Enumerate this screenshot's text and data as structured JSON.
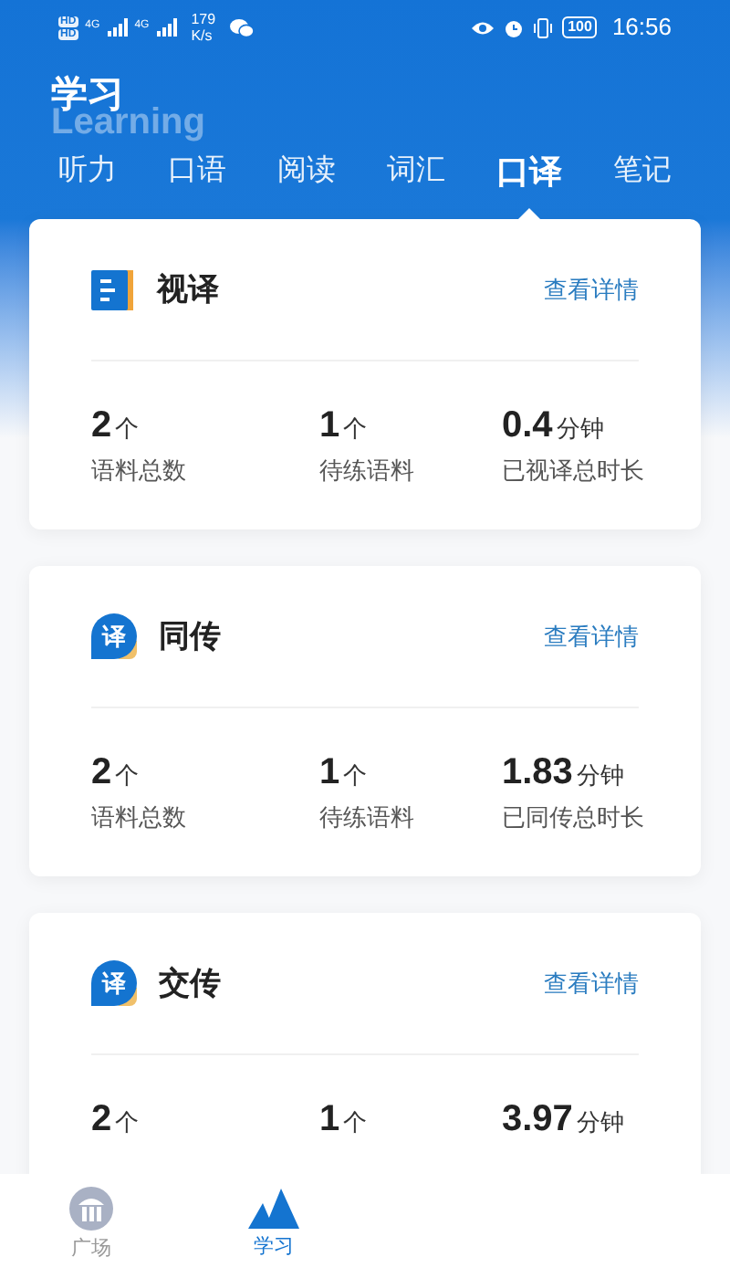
{
  "status_bar": {
    "sim_labels": [
      "HD",
      "HD"
    ],
    "network_labels": [
      "4G",
      "4G"
    ],
    "speed": "179",
    "speed_unit": "K/s",
    "battery": "100",
    "time": "16:56"
  },
  "header": {
    "title": "学习",
    "subtitle": "Learning"
  },
  "tabs": [
    {
      "label": "听力",
      "selected": false
    },
    {
      "label": "口语",
      "selected": false
    },
    {
      "label": "阅读",
      "selected": false
    },
    {
      "label": "词汇",
      "selected": false
    },
    {
      "label": "口译",
      "selected": true
    },
    {
      "label": "笔记",
      "selected": false
    }
  ],
  "cards": [
    {
      "kind": "document",
      "title": "视译",
      "link": "查看详情",
      "stats": [
        {
          "value": "2",
          "unit": "个",
          "label": "语料总数"
        },
        {
          "value": "1",
          "unit": "个",
          "label": "待练语料"
        },
        {
          "value": "0.4",
          "unit": "分钟",
          "label": "已视译总时长"
        }
      ]
    },
    {
      "kind": "badge",
      "badge": "译",
      "title": "同传",
      "link": "查看详情",
      "stats": [
        {
          "value": "2",
          "unit": "个",
          "label": "语料总数"
        },
        {
          "value": "1",
          "unit": "个",
          "label": "待练语料"
        },
        {
          "value": "1.83",
          "unit": "分钟",
          "label": "已同传总时长"
        }
      ]
    },
    {
      "kind": "badge",
      "badge": "译",
      "title": "交传",
      "link": "查看详情",
      "stats": [
        {
          "value": "2",
          "unit": "个"
        },
        {
          "value": "1",
          "unit": "个"
        },
        {
          "value": "3.97",
          "unit": "分钟"
        }
      ]
    }
  ],
  "bottom_nav": [
    {
      "kind": "plaza",
      "label": "广场",
      "selected": false
    },
    {
      "kind": "study",
      "label": "学习",
      "selected": true
    }
  ]
}
